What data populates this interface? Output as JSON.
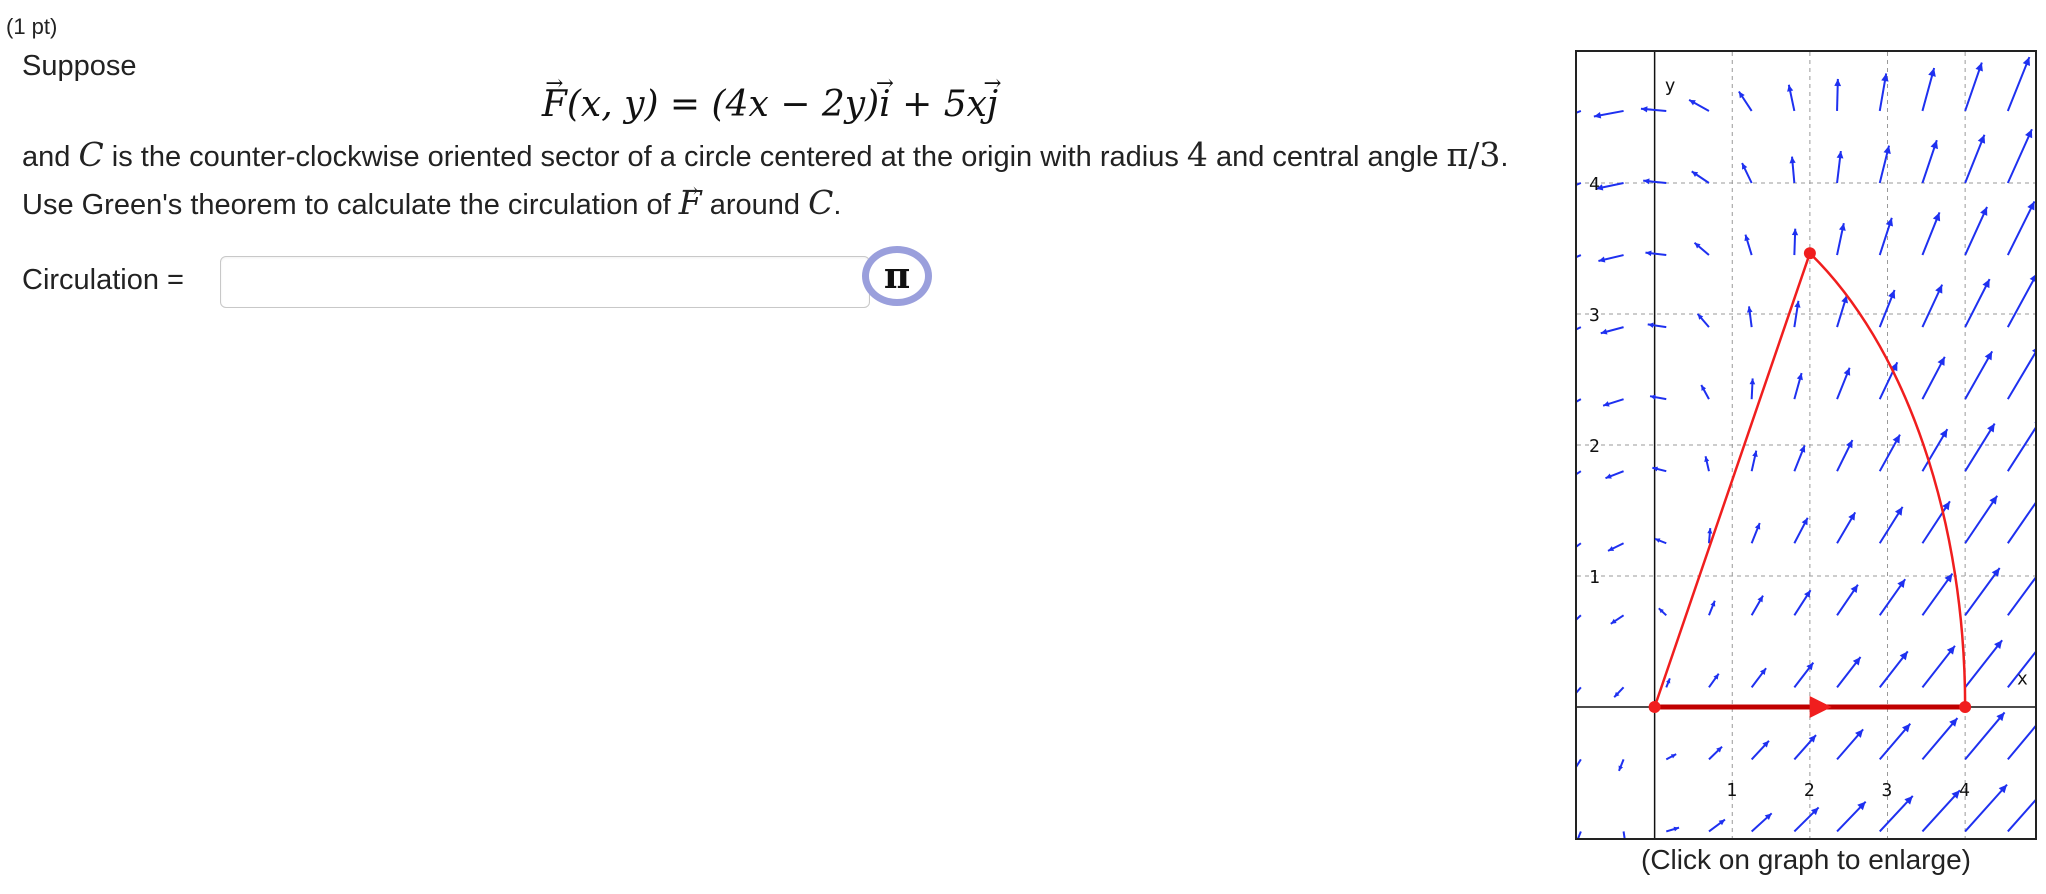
{
  "problem": {
    "points": "(1 pt)",
    "intro": "Suppose",
    "formula": {
      "F": "F",
      "lhs_args": "(x, y) = ",
      "mid": "(4x − 2y)",
      "i": "i",
      "plus": " + 5x",
      "j": "j"
    },
    "paragraph": {
      "t1": "and ",
      "C1": "C",
      "t2": " is the counter-clockwise oriented sector of a circle centered at the origin with radius ",
      "radius": "4",
      "t3": " and central angle ",
      "angle": "π/3",
      "t4": ". Use Green's theorem to calculate the circulation of ",
      "F": "F",
      "t5": " around ",
      "C2": "C",
      "t6": "."
    },
    "answer": {
      "label": "Circulation =",
      "value": "",
      "placeholder": ""
    },
    "pi_button": {
      "label": "π"
    }
  },
  "graph": {
    "caption": "(Click on graph to enlarge)",
    "x_axis_label": "x",
    "y_axis_label": "y",
    "x_ticks": [
      "1",
      "2",
      "3",
      "4"
    ],
    "y_ticks": [
      "1",
      "2",
      "3",
      "4"
    ],
    "vector_color": "#1e30f0",
    "curve_color": "#f01e1e",
    "grid_color": "#9a9a9a",
    "field": {
      "x_expr": "4x - 2y",
      "y_expr": "5x"
    },
    "ranges": {
      "xmin": -1,
      "xmax": 4.9,
      "ymin": -1,
      "ymax": 5
    },
    "sector": {
      "radius": 4,
      "angle_deg": 60
    }
  }
}
